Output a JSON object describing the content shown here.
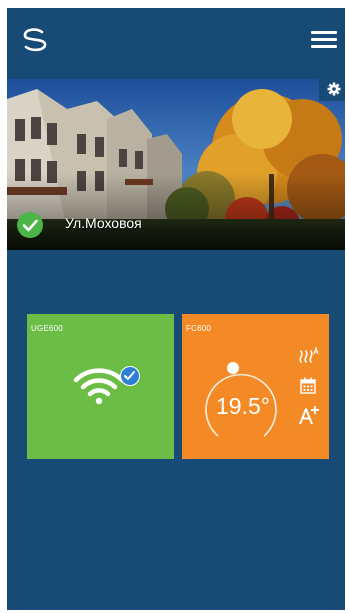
{
  "location": {
    "name": "Ул.Моховоя"
  },
  "devices": [
    {
      "label": "UGE600",
      "icon": "wifi-icon",
      "status": "connected",
      "color": "#6cbd45"
    },
    {
      "label": "FC600",
      "temperature": "19.5°",
      "color": "#f48a26",
      "icons": [
        "heating-mode-icon",
        "schedule-icon",
        "auto-mode-icon"
      ]
    }
  ],
  "colors": {
    "background": "#184a76",
    "accent_green": "#6cbd45",
    "accent_orange": "#f48a26",
    "status_check": "#4bb547",
    "check_badge": "#2f7fd6"
  }
}
